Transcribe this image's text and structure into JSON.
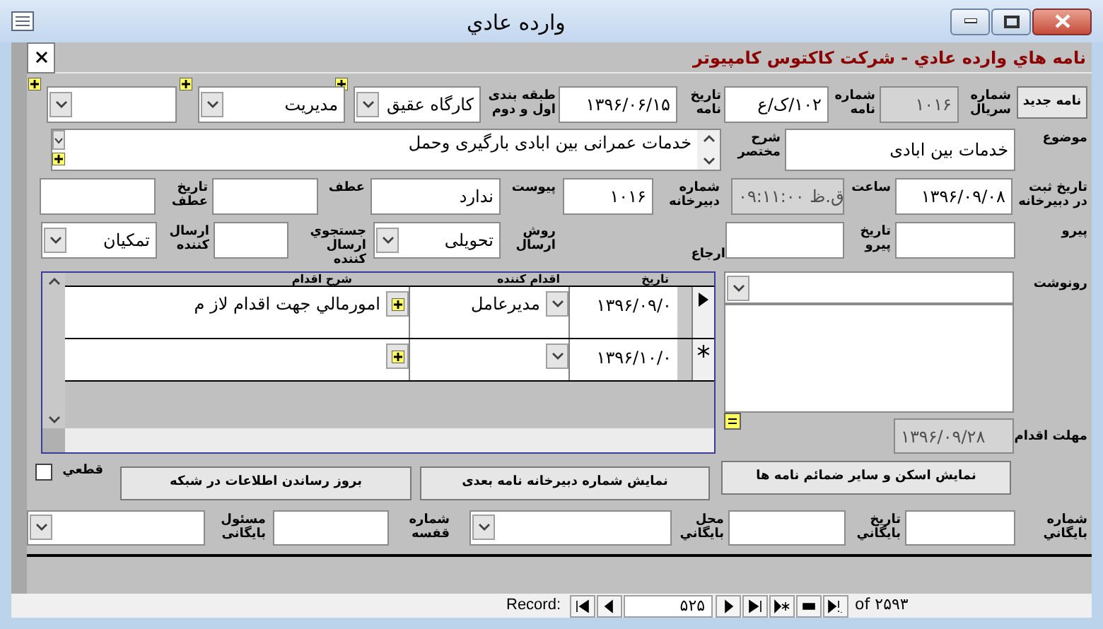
{
  "window": {
    "title": "وارده عادي"
  },
  "form_title": "نامه هاي وارده عادي - شركت كاكتوس كامپيوتر",
  "new_letter_button": "نامه جديد",
  "header_fields": [
    {
      "label": "شماره سريال",
      "value": "١٠١۶",
      "kind": "readonly"
    },
    {
      "label": "شماره نامه",
      "value": "١٠٢/ک/ع",
      "kind": "text"
    },
    {
      "label": "تاريخ نامه",
      "value": "١٣٩۶/٠۶/١۵",
      "kind": "date"
    },
    {
      "label": "طبقه بندی اول و دوم",
      "value": "كارگاه عقيق",
      "kind": "combo"
    },
    {
      "value": "مديريت",
      "kind": "combo"
    },
    {
      "kind": "combo"
    }
  ],
  "subject": {
    "label": "موضوع",
    "value": "خدمات بين ابادی"
  },
  "summary": {
    "label": "شرح مختصر",
    "value": "خدمات عمرانی بين ابادی بارگيری وحمل"
  },
  "registry_fields": [
    {
      "label": "تاريخ ثبت در دبيرخانه",
      "value": "١٣٩۶/٠٩/٠٨",
      "kind": "date"
    },
    {
      "label": "ساعت",
      "value": "ق.ظ ٠٩:١١:٠٠",
      "kind": "readonly_date"
    },
    {
      "label": "شماره دبيرخانه",
      "value": "١٠١۶",
      "kind": "text"
    },
    {
      "label": "پيوست",
      "value": "ندارد",
      "kind": "text"
    },
    {
      "label": "عطف",
      "kind": "text"
    },
    {
      "label": "تاريخ عطف",
      "kind": "text"
    }
  ],
  "reference_fields": [
    {
      "label": "پيرو",
      "kind": "text"
    },
    {
      "label": "تاريخ پيرو",
      "kind": "text"
    },
    {
      "label": "ارجاع",
      "kind": "caption"
    },
    {
      "label": "روش ارسال",
      "value": "تحويلی",
      "kind": "combo"
    },
    {
      "label": "جستجوي ارسال كننده",
      "kind": "text"
    },
    {
      "label": "ارسال كننده",
      "value": "تمكيان",
      "kind": "combo"
    }
  ],
  "actions": {
    "columns": [
      "تاريخ",
      "اقدام كننده",
      "شرح اقدام"
    ],
    "rows": [
      {
        "kind": "current",
        "date": "١٣٩۶/٠٩/٠",
        "actor": "مديرعامل",
        "description": "امورمالي جهت اقدام لاز م"
      },
      {
        "kind": "new",
        "date": "١٣٩۶/١٠/٠"
      }
    ]
  },
  "copy_to": {
    "label": "رونوشت"
  },
  "deadline": {
    "label": "مهلت اقدام",
    "value": "١٣٩۶/٠٩/٢٨"
  },
  "final_checkbox": {
    "label": "قطعي",
    "checked": false
  },
  "buttons": [
    "نمايش اسكن و ساير ضمائم نامه ها",
    "نمايش  شماره دبيرخانه نامه بعدی",
    "بروز رساندن اطلاعات در شبكه"
  ],
  "archive_fields": [
    {
      "label": "شماره بايگاني",
      "kind": "text"
    },
    {
      "label": "تاريخ بايگاني",
      "kind": "text"
    },
    {
      "label": "محل بايگاني",
      "kind": "combo"
    },
    {
      "label": "شماره قفسه",
      "kind": "text"
    },
    {
      "label": "مسئول بايگانی",
      "kind": "combo"
    }
  ],
  "navigation": {
    "label": "Record:",
    "current": "۵۲۵",
    "total": "of ٢۵٩٣"
  }
}
